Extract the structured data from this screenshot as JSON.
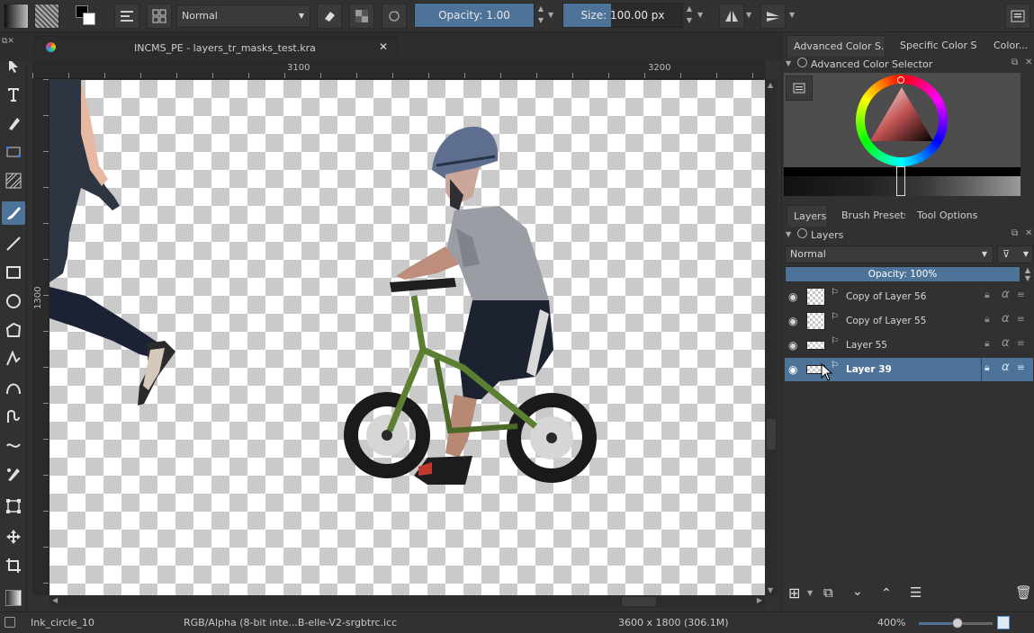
{
  "toolbar": {
    "blend_mode": "Normal",
    "opacity_label": "Opacity:  1.00",
    "opacity_value": 1.0,
    "size_label": "Size:  100.00 px",
    "size_fill_fraction": 0.4
  },
  "document": {
    "tab_title": "INCMS_PE - layers_tr_masks_test.kra"
  },
  "rulers": {
    "h_ticks": [
      "3100",
      "3200"
    ],
    "v_ticks": [
      "1300"
    ]
  },
  "docker_tabs": {
    "top": [
      "Advanced Color S...",
      "Specific Color S...",
      "Color..."
    ],
    "bottom": [
      "Layers",
      "Brush Presets",
      "Tool Options"
    ]
  },
  "color_selector": {
    "title": "Advanced Color Selector"
  },
  "layers_panel": {
    "title": "Layers",
    "blend_mode": "Normal",
    "opacity_label": "Opacity:  100%",
    "layers": [
      {
        "name": "Copy of Layer 56",
        "selected": false
      },
      {
        "name": "Copy of Layer 55",
        "selected": false
      },
      {
        "name": "Layer 55",
        "selected": false
      },
      {
        "name": "Layer 39",
        "selected": true
      }
    ]
  },
  "status": {
    "brush": "Ink_circle_10",
    "color_space": "RGB/Alpha (8-bit inte...B-elle-V2-srgbtrc.icc",
    "dimensions": "3600 x 1800 (306.1M)",
    "zoom": "400%"
  },
  "colors": {
    "accent": "#4e7399",
    "background": "#313131"
  }
}
